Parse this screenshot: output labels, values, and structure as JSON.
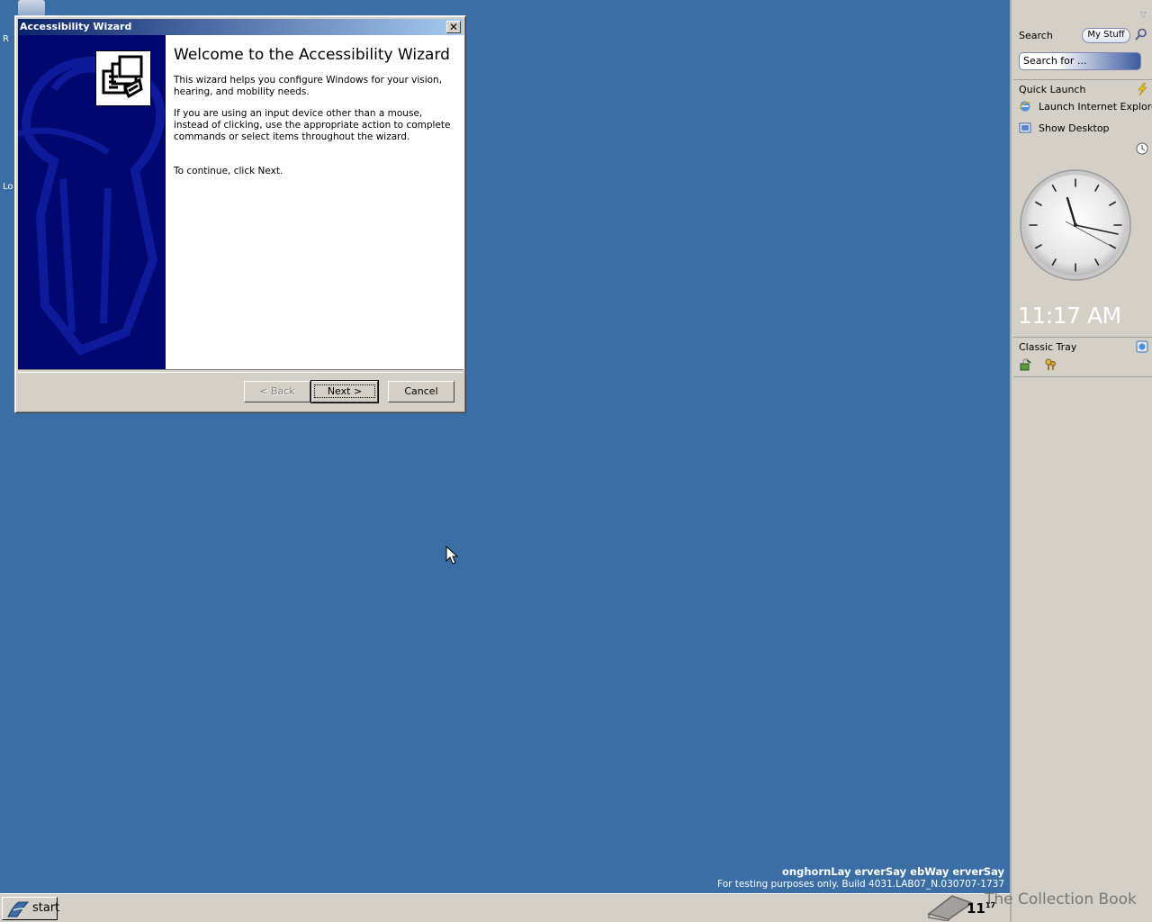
{
  "desktop": {
    "clip_labels": [
      "R",
      "Lo"
    ]
  },
  "wizard": {
    "title": "Accessibility Wizard",
    "close_glyph": "✕",
    "heading": "Welcome to the Accessibility Wizard",
    "paragraphs": [
      "This wizard helps you configure Windows for your vision, hearing, and mobility needs.",
      "If you are using an input device other than a mouse, instead of clicking, use the appropriate action to complete commands or select items throughout the wizard."
    ],
    "continue_text": "To continue, click Next.",
    "buttons": {
      "back": "< Back",
      "next": "Next >",
      "cancel": "Cancel"
    }
  },
  "sidebar": {
    "search_label": "Search",
    "my_stuff": "My Stuff",
    "search_placeholder": "Search for ...",
    "quick_launch": {
      "title": "Quick Launch",
      "items": [
        "Launch Internet Explorer",
        "Show Desktop"
      ]
    },
    "clock_time": "11:17 AM",
    "classic_tray": "Classic Tray"
  },
  "watermark": {
    "line1": "onghornLay erverSay ebWay erverSay",
    "line2": "For testing purposes only. Build 4031.LAB07_N.030707-1737"
  },
  "taskbar": {
    "start_label": "start",
    "clock_hour": "11",
    "clock_min": "17",
    "overlay_text": "The Collection Book"
  },
  "colors": {
    "desktop": "#3a6ea5",
    "title_bar_start": "#0a246a",
    "wizard_side": "#000870",
    "face": "#d4d0c8"
  }
}
